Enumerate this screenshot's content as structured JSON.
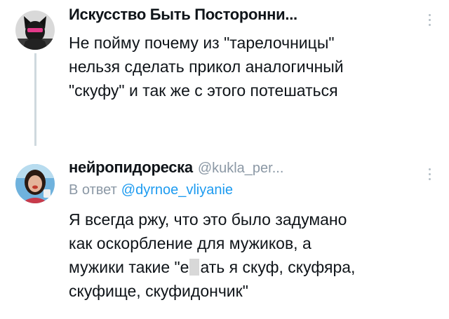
{
  "tweets": [
    {
      "author_name": "Искусство Быть Посторонни...",
      "handle": "",
      "reply_prefix": "",
      "reply_mention": "",
      "body_lines": [
        "Не пойму почему из \"тарелочницы\"",
        "нельзя сделать прикол аналогичный",
        "\"скуфу\" и так же с этого потешаться"
      ]
    },
    {
      "author_name": "нейропидореска",
      "handle": "@kukla_per...",
      "reply_prefix": "В ответ",
      "reply_mention": "@dyrnoe_vliyanie",
      "body_lines": [
        "Я всегда ржу, что это было задумано",
        "как оскорбление для мужиков, а",
        "мужики такие \"е",
        "ать я скуф, скуфяра,",
        "скуфище, скуфидончик\""
      ]
    }
  ],
  "colors": {
    "text": "#0f1419",
    "secondary": "#8b98a5",
    "link": "#1d9bf0",
    "thread_line": "#cfd9de"
  },
  "icons": [
    "cat-ear-avatar",
    "woman-avatar",
    "more-options-icon"
  ]
}
